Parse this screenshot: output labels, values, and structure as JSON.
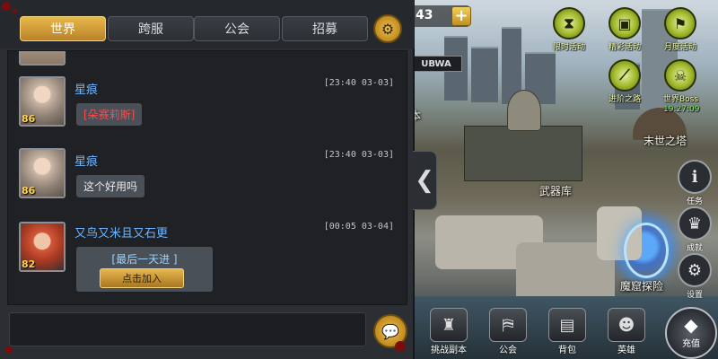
{
  "tabs": [
    {
      "label": "世界",
      "active": true
    },
    {
      "label": "跨服",
      "active": false
    },
    {
      "label": "公会",
      "active": false
    },
    {
      "label": "招募",
      "active": false
    }
  ],
  "settings_icon": "gear-icon",
  "messages": [
    {
      "user": "星痕",
      "level": "86",
      "time": "[23:40 03-03]",
      "text": "[朵赛莉斯]",
      "text_color": "#ff4a4a"
    },
    {
      "user": "星痕",
      "level": "86",
      "time": "[23:40 03-03]",
      "text": "这个好用吗",
      "text_color": "#e8eaec"
    },
    {
      "user": "又鸟又米且又石更",
      "level": "82",
      "time": "[00:05 03-04]",
      "card_title": "[最后一天进 ]",
      "card_button": "点击加入"
    }
  ],
  "input": {
    "placeholder": ""
  },
  "send_icon": "chat-bubble-icon",
  "collapse_icon": "chevron-left-icon",
  "resource": {
    "value": "43",
    "add_icon": "plus-icon"
  },
  "top_buttons": [
    {
      "label": "限时活动",
      "icon": "hourglass-icon"
    },
    {
      "label": "精彩活动",
      "icon": "gift-icon"
    },
    {
      "label": "月度活动",
      "icon": "flag-icon"
    },
    {
      "label": "进阶之路",
      "icon": "road-icon"
    },
    {
      "label": "世界Boss",
      "icon": "skull-icon",
      "timer": "19:27:09"
    }
  ],
  "locations": [
    {
      "label": "末世之塔"
    },
    {
      "label": "武器库"
    },
    {
      "label": "魔窟探险"
    },
    {
      "label": "本"
    }
  ],
  "side_buttons": [
    {
      "label": "任务",
      "icon": "task-icon"
    },
    {
      "label": "成就",
      "icon": "trophy-icon"
    },
    {
      "label": "设置",
      "icon": "gear-icon"
    }
  ],
  "bottom_buttons": [
    {
      "label": "挑战副本",
      "icon": "tower-icon"
    },
    {
      "label": "公会",
      "icon": "banner-icon"
    },
    {
      "label": "背包",
      "icon": "backpack-icon"
    },
    {
      "label": "英雄",
      "icon": "hero-head-icon"
    }
  ],
  "recharge": {
    "label": "充值",
    "icon": "diamond-icon"
  },
  "colors": {
    "accent_gold": "#e9b84a",
    "username_blue": "#6fb6ff",
    "panel_bg": "#2b2e33"
  }
}
